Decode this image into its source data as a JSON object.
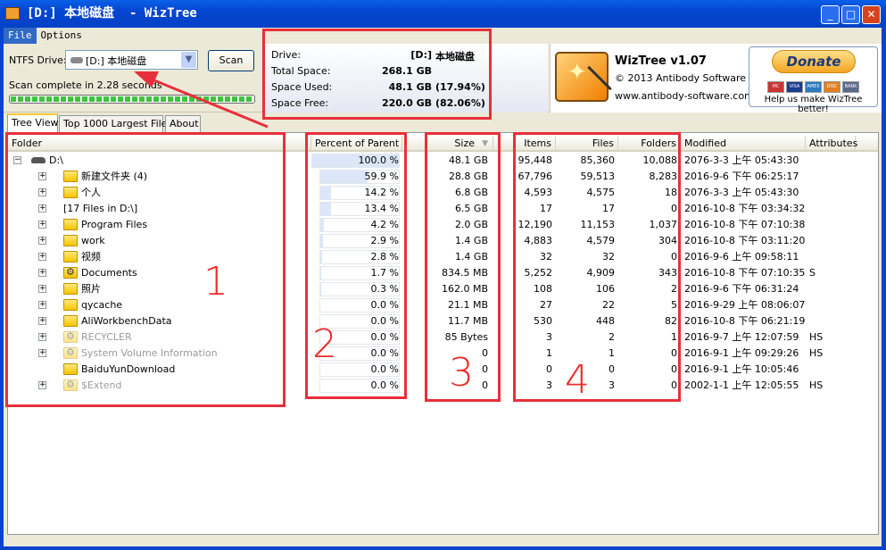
{
  "window": {
    "title": "[D:] 本地磁盘  - WizTree",
    "buttons": [
      "_",
      "□",
      "✕"
    ]
  },
  "menu": [
    "File",
    "Options"
  ],
  "scan": {
    "drive_label": "NTFS Drive:",
    "drive_value": "[D:] 本地磁盘",
    "scan_button": "Scan",
    "status": "Scan complete in 2.28 seconds",
    "progress_percent": 100
  },
  "drive_info": {
    "rows": [
      {
        "label": "Drive:",
        "value": "[D:]",
        "extra": "本地磁盘"
      },
      {
        "label": "Total Space:",
        "value": "268.1 GB",
        "extra": ""
      },
      {
        "label": "Space Used:",
        "value": "48.1 GB",
        "extra": "(17.94%)"
      },
      {
        "label": "Space Free:",
        "value": "220.0 GB",
        "extra": "(82.06%)"
      }
    ]
  },
  "about": {
    "name": "WizTree v1.07",
    "copyright": "© 2013 Antibody Software",
    "url": "www.antibody-software.com",
    "donate": "Donate",
    "cards": [
      "MC",
      "VISA",
      "AMEX",
      "DISC",
      "BANK"
    ],
    "donate_note": "Help us make WizTree better!"
  },
  "tabs": [
    "Tree View",
    "Top 1000 Largest Files",
    "About"
  ],
  "columns": {
    "folder": "Folder",
    "percent": "Percent of Parent",
    "size": "Size",
    "items": "Items",
    "files": "Files",
    "folders": "Folders",
    "modified": "Modified",
    "attributes": "Attributes"
  },
  "sort": {
    "column": "Size",
    "direction": "descending"
  },
  "rows": [
    {
      "name": "D:\\",
      "level": 0,
      "icon": "drive",
      "toggle": "−",
      "pct": "100.0 %",
      "pctv": 100,
      "size": "48.1 GB",
      "items": "95,448",
      "files": "85,360",
      "folders": "10,088",
      "modified": "2076-3-3 上午 05:43:30",
      "attr": ""
    },
    {
      "name": "新建文件夹 (4)",
      "level": 1,
      "icon": "folder",
      "toggle": "+",
      "pct": "59.9 %",
      "pctv": 59.9,
      "size": "28.8 GB",
      "items": "67,796",
      "files": "59,513",
      "folders": "8,283",
      "modified": "2016-9-6 下午 06:25:17",
      "attr": ""
    },
    {
      "name": "个人",
      "level": 1,
      "icon": "folder",
      "toggle": "+",
      "pct": "14.2 %",
      "pctv": 14.2,
      "size": "6.8 GB",
      "items": "4,593",
      "files": "4,575",
      "folders": "18",
      "modified": "2076-3-3 上午 05:43:30",
      "attr": ""
    },
    {
      "name": "[17 Files in D:\\]",
      "level": 1,
      "icon": "none",
      "toggle": "+",
      "pct": "13.4 %",
      "pctv": 13.4,
      "size": "6.5 GB",
      "items": "17",
      "files": "17",
      "folders": "0",
      "modified": "2016-10-8 下午 03:34:32",
      "attr": ""
    },
    {
      "name": "Program Files",
      "level": 1,
      "icon": "folder",
      "toggle": "+",
      "pct": "4.2 %",
      "pctv": 4.2,
      "size": "2.0 GB",
      "items": "12,190",
      "files": "11,153",
      "folders": "1,037",
      "modified": "2016-10-8 下午 07:10:38",
      "attr": ""
    },
    {
      "name": "work",
      "level": 1,
      "icon": "folder",
      "toggle": "+",
      "pct": "2.9 %",
      "pctv": 2.9,
      "size": "1.4 GB",
      "items": "4,883",
      "files": "4,579",
      "folders": "304",
      "modified": "2016-10-8 下午 03:11:20",
      "attr": ""
    },
    {
      "name": "视频",
      "level": 1,
      "icon": "folder",
      "toggle": "+",
      "pct": "2.8 %",
      "pctv": 2.8,
      "size": "1.4 GB",
      "items": "32",
      "files": "32",
      "folders": "0",
      "modified": "2016-9-6 上午 09:58:11",
      "attr": ""
    },
    {
      "name": "Documents",
      "level": 1,
      "icon": "system-folder",
      "toggle": "+",
      "pct": "1.7 %",
      "pctv": 1.7,
      "size": "834.5 MB",
      "items": "5,252",
      "files": "4,909",
      "folders": "343",
      "modified": "2016-10-8 下午 07:10:35",
      "attr": "S"
    },
    {
      "name": "照片",
      "level": 1,
      "icon": "folder",
      "toggle": "+",
      "pct": "0.3 %",
      "pctv": 0.3,
      "size": "162.0 MB",
      "items": "108",
      "files": "106",
      "folders": "2",
      "modified": "2016-9-6 下午 06:31:24",
      "attr": ""
    },
    {
      "name": "qycache",
      "level": 1,
      "icon": "folder",
      "toggle": "+",
      "pct": "0.0 %",
      "pctv": 0,
      "size": "21.1 MB",
      "items": "27",
      "files": "22",
      "folders": "5",
      "modified": "2016-9-29 上午 08:06:07",
      "attr": ""
    },
    {
      "name": "AliWorkbenchData",
      "level": 1,
      "icon": "folder",
      "toggle": "+",
      "pct": "0.0 %",
      "pctv": 0,
      "size": "11.7 MB",
      "items": "530",
      "files": "448",
      "folders": "82",
      "modified": "2016-10-8 下午 06:21:19",
      "attr": ""
    },
    {
      "name": "RECYCLER",
      "level": 1,
      "icon": "hidden-system-folder",
      "toggle": "+",
      "pct": "0.0 %",
      "pctv": 0,
      "size": "85 Bytes",
      "items": "3",
      "files": "2",
      "folders": "1",
      "modified": "2016-9-7 上午 12:07:59",
      "attr": "HS"
    },
    {
      "name": "System Volume Information",
      "level": 1,
      "icon": "hidden-system-folder",
      "toggle": "+",
      "pct": "0.0 %",
      "pctv": 0,
      "size": "0",
      "items": "1",
      "files": "1",
      "folders": "0",
      "modified": "2016-9-1 上午 09:29:26",
      "attr": "HS"
    },
    {
      "name": "BaiduYunDownload",
      "level": 1,
      "icon": "folder",
      "toggle": "",
      "pct": "0.0 %",
      "pctv": 0,
      "size": "0",
      "items": "0",
      "files": "0",
      "folders": "0",
      "modified": "2016-9-1 上午 10:05:46",
      "attr": ""
    },
    {
      "name": "$Extend",
      "level": 1,
      "icon": "hidden-system-folder",
      "toggle": "+",
      "pct": "0.0 %",
      "pctv": 0,
      "size": "0",
      "items": "3",
      "files": "3",
      "folders": "0",
      "modified": "2002-1-1 上午 12:05:55",
      "attr": "HS"
    }
  ],
  "annotations": {
    "color": "#e8303a",
    "labels": [
      "1",
      "2",
      "3",
      "4"
    ]
  }
}
